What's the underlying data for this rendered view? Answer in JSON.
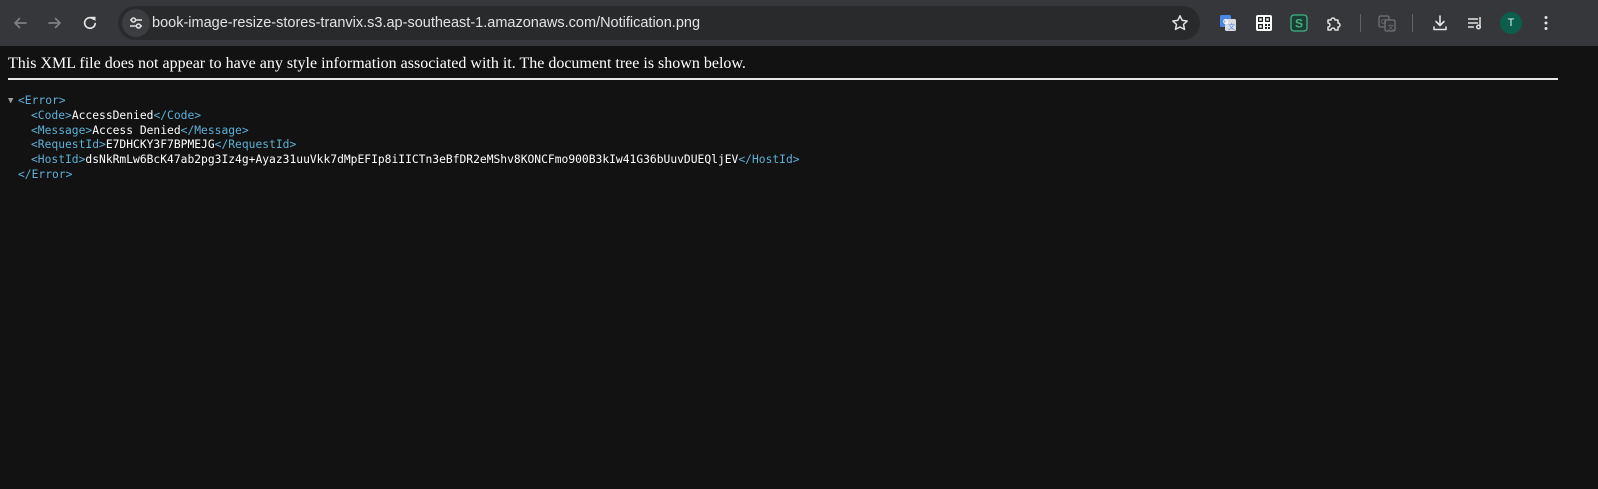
{
  "browser": {
    "url": "book-image-resize-stores-tranvix.s3.ap-southeast-1.amazonaws.com/Notification.png",
    "avatar_initial": "T",
    "icons": {
      "back": "arrow-left-icon",
      "forward": "arrow-right-icon",
      "reload": "reload-icon",
      "site_info": "tune-icon",
      "bookmark": "star-icon",
      "ext1": "google-translate-icon",
      "ext2": "qr-code-icon",
      "ext3": "s-extension-icon",
      "ext4": "puzzle-icon",
      "ext5": "translate-page-icon",
      "download": "download-icon",
      "reading_list": "reading-list-icon",
      "menu": "kebab-menu-icon"
    },
    "colors": {
      "toolbar": "#36373a",
      "omnibox": "#282a2c",
      "avatar": "#0b5e4a"
    }
  },
  "xml_viewer": {
    "notice": "This XML file does not appear to have any style information associated with it. The document tree is shown below.",
    "toggle_glyph": "▼",
    "root": {
      "open": "<Error>",
      "close": "</Error>"
    },
    "children": [
      {
        "open": "<Code>",
        "value": "AccessDenied",
        "close": "</Code>"
      },
      {
        "open": "<Message>",
        "value": "Access Denied",
        "close": "</Message>"
      },
      {
        "open": "<RequestId>",
        "value": "E7DHCKY3F7BPMEJG",
        "close": "</RequestId>"
      },
      {
        "open": "<HostId>",
        "value": "dsNkRmLw6BcK47ab2pg3Iz4g+Ayaz31uuVkk7dMpEFIp8iIICTn3eBfDR2eMShv8KONCFmo900B3kIw41G36bUuvDUEQljEV",
        "close": "</HostId>"
      }
    ],
    "colors": {
      "tag": "#5db0d7",
      "text": "#ffffff",
      "background": "#121212"
    }
  }
}
